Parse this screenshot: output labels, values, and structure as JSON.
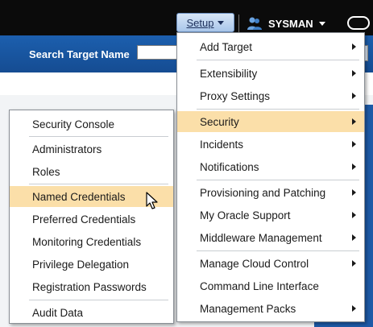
{
  "topbar": {
    "setup_label": "Setup",
    "user_label": "SYSMAN"
  },
  "search": {
    "label": "Search Target Name",
    "value": "",
    "placeholder": ""
  },
  "setup_menu": {
    "items": [
      {
        "label": "Add Target",
        "has_submenu": true
      },
      {
        "label": "Extensibility",
        "has_submenu": true
      },
      {
        "label": "Proxy Settings",
        "has_submenu": true
      },
      {
        "label": "Security",
        "has_submenu": true,
        "highlighted": true
      },
      {
        "label": "Incidents",
        "has_submenu": true
      },
      {
        "label": "Notifications",
        "has_submenu": true
      },
      {
        "label": "Provisioning and Patching",
        "has_submenu": true
      },
      {
        "label": "My Oracle Support",
        "has_submenu": true
      },
      {
        "label": "Middleware Management",
        "has_submenu": true
      },
      {
        "label": "Manage Cloud Control",
        "has_submenu": true
      },
      {
        "label": "Command Line Interface",
        "has_submenu": false
      },
      {
        "label": "Management Packs",
        "has_submenu": true
      }
    ]
  },
  "security_menu": {
    "items": [
      {
        "label": "Security Console"
      },
      {
        "label": "Administrators"
      },
      {
        "label": "Roles"
      },
      {
        "label": "Named Credentials",
        "highlighted": true
      },
      {
        "label": "Preferred Credentials"
      },
      {
        "label": "Monitoring Credentials"
      },
      {
        "label": "Privilege Delegation"
      },
      {
        "label": "Registration Passwords"
      },
      {
        "label": "Audit Data"
      }
    ]
  },
  "colors": {
    "topbar": "#0b0b0b",
    "search_band": "#1c5fae",
    "highlight": "#fbdfa9",
    "setup_button": "#a9c6ea"
  },
  "icons": {
    "user": "user-icon",
    "submenu": "submenu-arrow-icon",
    "cursor": "mouse-pointer-icon"
  }
}
